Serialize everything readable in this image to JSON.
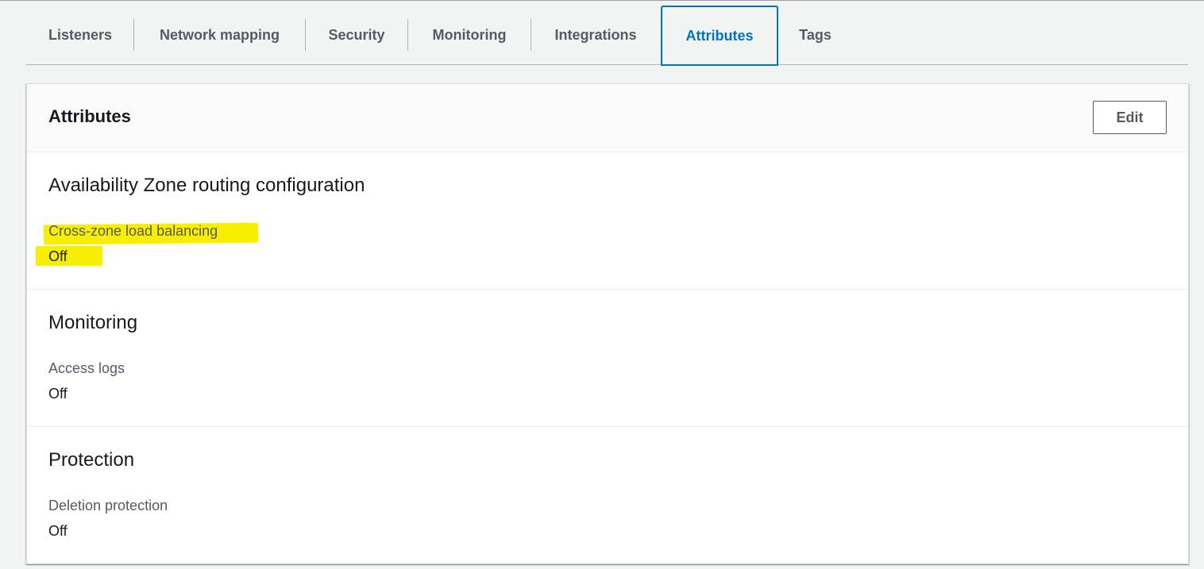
{
  "tabs": [
    {
      "label": "Listeners"
    },
    {
      "label": "Network mapping"
    },
    {
      "label": "Security"
    },
    {
      "label": "Monitoring"
    },
    {
      "label": "Integrations"
    },
    {
      "label": "Attributes",
      "active": true
    },
    {
      "label": "Tags"
    }
  ],
  "panel": {
    "title": "Attributes",
    "edit_label": "Edit"
  },
  "sections": [
    {
      "title": "Availability Zone routing configuration",
      "attributes": [
        {
          "label": "Cross-zone load balancing",
          "value": "Off",
          "highlighted": true
        }
      ]
    },
    {
      "title": "Monitoring",
      "attributes": [
        {
          "label": "Access logs",
          "value": "Off"
        }
      ]
    },
    {
      "title": "Protection",
      "attributes": [
        {
          "label": "Deletion protection",
          "value": "Off"
        }
      ]
    }
  ],
  "colors": {
    "accent": "#0073bb",
    "highlight": "#f8ef00",
    "background": "#f2f3f3"
  }
}
